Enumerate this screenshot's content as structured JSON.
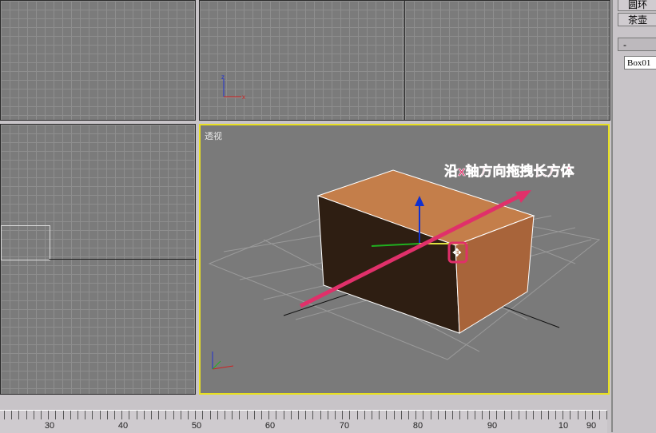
{
  "panel": {
    "buttons": [
      "圆环",
      "茶壶"
    ],
    "rollout_label": "-",
    "object_name": "Box01"
  },
  "viewports": {
    "perspective_label": "透视"
  },
  "annotation": {
    "text": "沿x轴方向拖拽长方体",
    "color": "#e0306a"
  },
  "timeline": {
    "labels": [
      "30",
      "40",
      "50",
      "60",
      "70",
      "80",
      "90",
      "10",
      "90"
    ]
  },
  "colors": {
    "active_viewport": "#e8e020",
    "box": "#c07840"
  }
}
